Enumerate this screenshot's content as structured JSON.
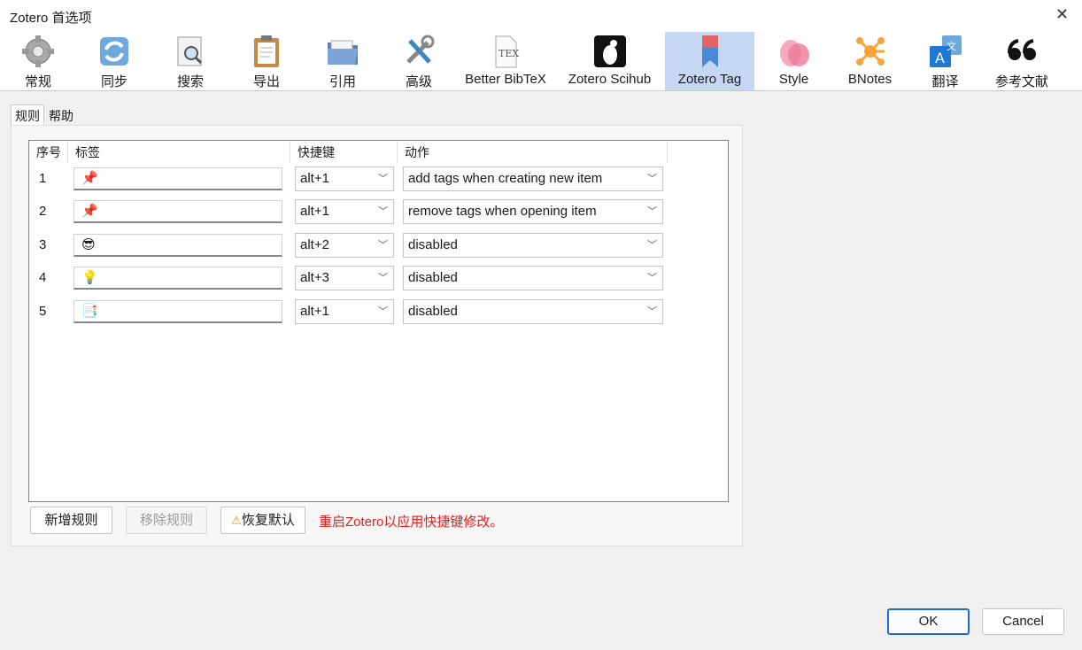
{
  "window": {
    "title": "Zotero 首选项"
  },
  "toolbar": {
    "panes": [
      {
        "label": "常规",
        "icon": "gear-icon"
      },
      {
        "label": "同步",
        "icon": "sync-icon"
      },
      {
        "label": "搜索",
        "icon": "search-icon"
      },
      {
        "label": "导出",
        "icon": "clipboard-icon"
      },
      {
        "label": "引用",
        "icon": "folder-icon"
      },
      {
        "label": "高级",
        "icon": "tools-icon"
      },
      {
        "label": "Better BibTeX",
        "icon": "tex-icon"
      },
      {
        "label": "Zotero Scihub",
        "icon": "scihub-icon"
      },
      {
        "label": "Zotero Tag",
        "icon": "bookmark-icon",
        "selected": true
      },
      {
        "label": "Style",
        "icon": "petal-icon"
      },
      {
        "label": "BNotes",
        "icon": "molecule-icon"
      },
      {
        "label": "翻译",
        "icon": "translate-icon"
      },
      {
        "label": "参考文献",
        "icon": "quote-icon"
      }
    ]
  },
  "subtabs": {
    "rules": "规则",
    "help": "帮助"
  },
  "table": {
    "headers": {
      "index": "序号",
      "tag": "标签",
      "shortcut": "快捷键",
      "action": "动作"
    },
    "rows": [
      {
        "index": "1",
        "tag": "📌",
        "shortcut": "alt+1",
        "action": "add tags when creating new item"
      },
      {
        "index": "2",
        "tag": "📌",
        "shortcut": "alt+1",
        "action": "remove tags when opening item"
      },
      {
        "index": "3",
        "tag": "😎",
        "shortcut": "alt+2",
        "action": "disabled"
      },
      {
        "index": "4",
        "tag": "💡",
        "shortcut": "alt+3",
        "action": "disabled"
      },
      {
        "index": "5",
        "tag": "📑",
        "shortcut": "alt+1",
        "action": "disabled"
      }
    ]
  },
  "buttons": {
    "add": "新增规则",
    "remove": "移除规则",
    "restore": "恢复默认",
    "ok": "OK",
    "cancel": "Cancel"
  },
  "notice": "重启Zotero以应用快捷键修改。",
  "colors": {
    "accent": "#1a6dd4",
    "selected_pane": "#c5d7f2",
    "notice": "#e02020"
  }
}
